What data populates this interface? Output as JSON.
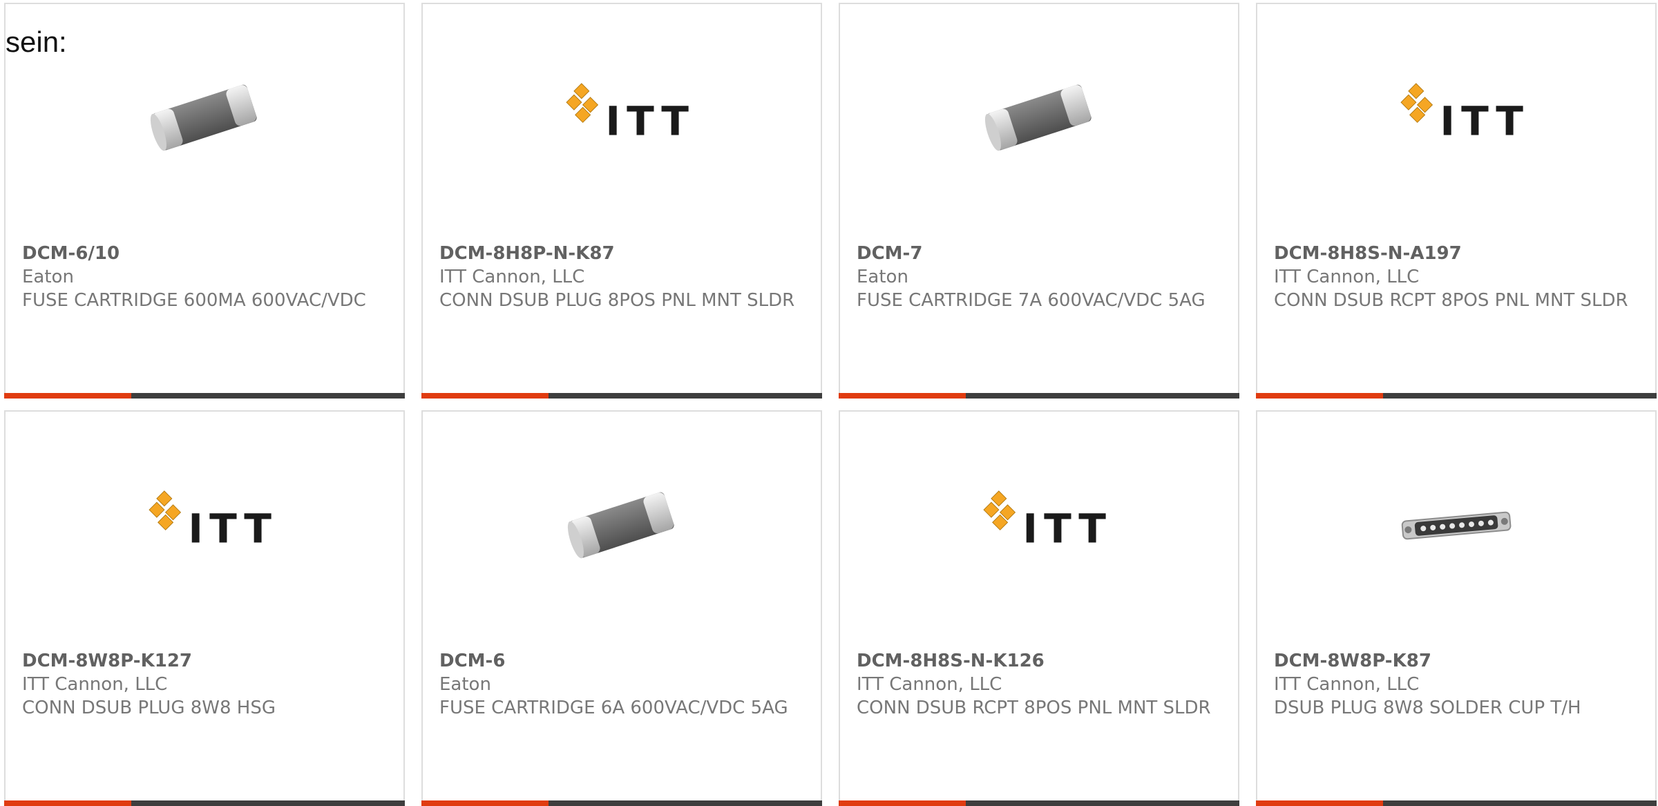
{
  "intro_text": "sein:",
  "theme": {
    "accent": "#e03c10",
    "bar": "#3e3e3e",
    "border": "#dddddd",
    "text": "#777777",
    "title": "#616161",
    "itt_orange": "#f5a623"
  },
  "products": [
    {
      "part": "DCM-6/10",
      "maker": "Eaton",
      "desc": "FUSE CARTRIDGE 600MA 600VAC/VDC",
      "image": "fuse-cartridge-icon"
    },
    {
      "part": "DCM-8H8P-N-K87",
      "maker": "ITT Cannon, LLC",
      "desc": "CONN DSUB PLUG 8POS PNL MNT SLDR",
      "image": "itt-logo-icon",
      "logo_text": "ITT"
    },
    {
      "part": "DCM-7",
      "maker": "Eaton",
      "desc": "FUSE CARTRIDGE 7A 600VAC/VDC 5AG",
      "image": "fuse-cartridge-icon"
    },
    {
      "part": "DCM-8H8S-N-A197",
      "maker": "ITT Cannon, LLC",
      "desc": "CONN DSUB RCPT 8POS PNL MNT SLDR",
      "image": "itt-logo-icon",
      "logo_text": "ITT"
    },
    {
      "part": "DCM-8W8P-K127",
      "maker": "ITT Cannon, LLC",
      "desc": "CONN DSUB PLUG 8W8 HSG",
      "image": "itt-logo-icon",
      "logo_text": "ITT"
    },
    {
      "part": "DCM-6",
      "maker": "Eaton",
      "desc": "FUSE CARTRIDGE 6A 600VAC/VDC 5AG",
      "image": "fuse-cartridge-icon"
    },
    {
      "part": "DCM-8H8S-N-K126",
      "maker": "ITT Cannon, LLC",
      "desc": "CONN DSUB RCPT 8POS PNL MNT SLDR",
      "image": "itt-logo-icon",
      "logo_text": "ITT"
    },
    {
      "part": "DCM-8W8P-K87",
      "maker": "ITT Cannon, LLC",
      "desc": "DSUB PLUG 8W8 SOLDER CUP T/H",
      "image": "dsub-connector-icon"
    }
  ]
}
